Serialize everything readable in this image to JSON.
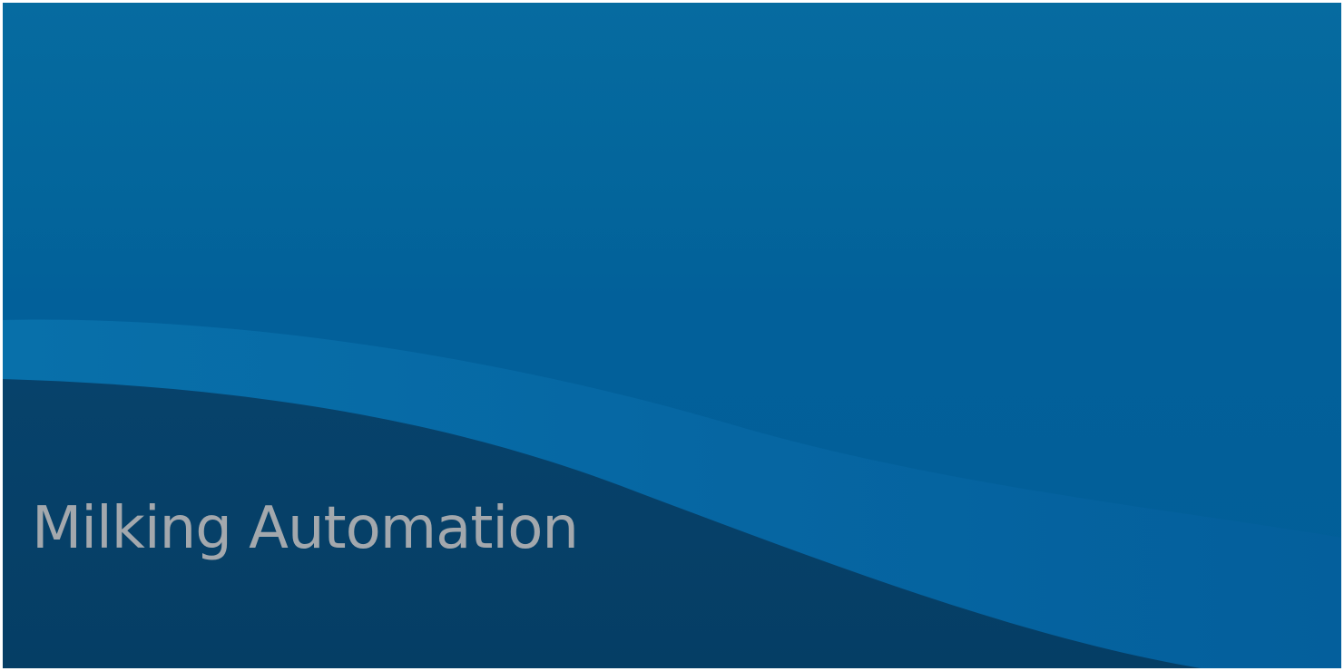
{
  "slide": {
    "title": "Milking Automation"
  },
  "colors": {
    "background_top": "#066ba0",
    "background_bottom": "#015e98",
    "light_wave": "#0669a5",
    "dark_wave": "#063f66",
    "title_text": "#a3a8ad"
  }
}
